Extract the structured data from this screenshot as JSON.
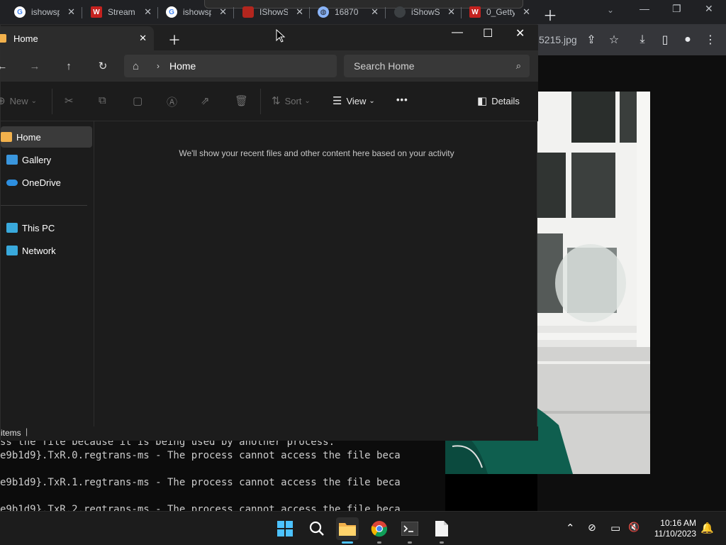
{
  "chrome": {
    "tabs": [
      {
        "title": "ishowsp",
        "favicon": "google-icon",
        "fav_type": "g"
      },
      {
        "title": "Stream",
        "favicon": "w-brand-icon",
        "fav_type": "w"
      },
      {
        "title": "ishowsp",
        "favicon": "google-icon",
        "fav_type": "g"
      },
      {
        "title": "IShowS",
        "favicon": "red-brand-icon",
        "fav_type": "red"
      },
      {
        "title": "16870",
        "favicon": "globe-icon",
        "fav_type": "globe"
      },
      {
        "title": "iShowS",
        "favicon": "dark-brand-icon",
        "fav_type": "dark"
      },
      {
        "title": "0_Getty",
        "favicon": "w-brand-icon",
        "fav_type": "w"
      }
    ],
    "omnibox_tail": "5215.jpg"
  },
  "explorer": {
    "tab_title": "Home",
    "address": {
      "crumb": "Home"
    },
    "search_placeholder": "Search Home",
    "commands": {
      "new": "New",
      "sort": "Sort",
      "view": "View",
      "more": "•••",
      "details": "Details"
    },
    "sidebar": [
      {
        "label": "Home",
        "icon": "home-icon",
        "color": "#f2b14c",
        "selected": true
      },
      {
        "label": "Gallery",
        "icon": "gallery-icon",
        "color": "#3a96dd"
      },
      {
        "label": "OneDrive",
        "icon": "onedrive-icon",
        "color": "#2d8fe0"
      },
      {
        "label": "This PC",
        "icon": "this-pc-icon",
        "color": "#39a9dc"
      },
      {
        "label": "Network",
        "icon": "network-icon",
        "color": "#39a9dc"
      }
    ],
    "empty_message": "We'll show your recent files and other content here based on your activity",
    "status": "items"
  },
  "terminal": {
    "lines": [
      "ss the file because it is being used by another process.",
      "e9b1d9}.TxR.0.regtrans-ms - The process cannot access the file beca",
      "e9b1d9}.TxR.1.regtrans-ms - The process cannot access the file beca",
      "e9b1d9}.TxR.2.regtrans-ms - The process cannot access the file beca"
    ]
  },
  "taskbar": {
    "time": "10:16 AM",
    "date": "11/10/2023"
  },
  "colors": {
    "accent": "#4cc2ff",
    "folder": "#f2b14c"
  }
}
